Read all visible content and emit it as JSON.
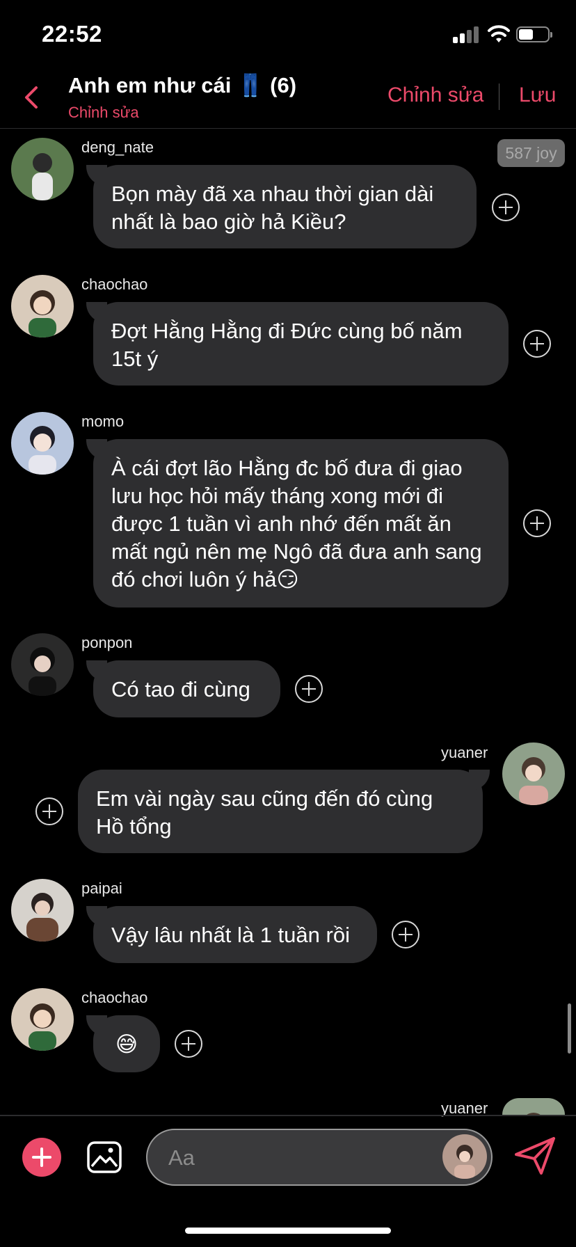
{
  "status_bar": {
    "time": "22:52"
  },
  "header": {
    "title": "Anh em như cái 👖 (6)",
    "subtitle": "Chỉnh sửa",
    "edit_label": "Chỉnh sửa",
    "save_label": "Lưu"
  },
  "badge": {
    "label": "587 joy"
  },
  "messages": [
    {
      "name": "deng_nate",
      "text": "Bọn mày đã xa nhau thời gian dài nhất là bao giờ hả Kiều?"
    },
    {
      "name": "chaochao",
      "text": "Đợt Hằng Hằng đi Đức cùng bố năm 15t ý"
    },
    {
      "name": "momo",
      "text": "À cái đợt lão Hằng đc bố đưa đi giao lưu học hỏi mấy tháng xong mới đi được 1 tuần vì anh nhớ đến mất ăn mất ngủ nên mẹ Ngô đã đưa anh sang đó chơi luôn ý hả😏"
    },
    {
      "name": "ponpon",
      "text": "Có tao đi cùng"
    },
    {
      "name": "yuaner",
      "text": "Em vài ngày sau cũng đến đó cùng Hồ tổng"
    },
    {
      "name": "paipai",
      "text": "Vậy lâu nhất là 1 tuần rồi"
    },
    {
      "name": "chaochao",
      "text": "😅"
    },
    {
      "name": "yuaner",
      "text": ""
    }
  ],
  "composer": {
    "placeholder": "Aa"
  },
  "colors": {
    "accent": "#ec4a6a",
    "bubble": "#2e2e30",
    "background": "#000000"
  }
}
